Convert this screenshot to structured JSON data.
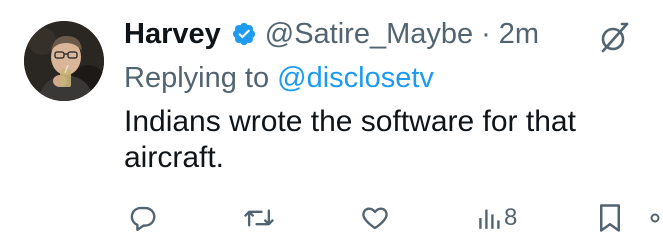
{
  "tweet": {
    "author": {
      "display_name": "Harvey",
      "handle": "@Satire_Maybe",
      "verified": true,
      "avatar_icon": "profile-photo"
    },
    "separator": "·",
    "time": "2m",
    "replying_label": "Replying to",
    "replying_to": "@disclosetv",
    "text": "Indians wrote the software for that aircraft.",
    "metrics": {
      "views": "8"
    },
    "icons": {
      "grok": "grok-icon",
      "reply": "reply-icon",
      "retweet": "retweet-icon",
      "like": "like-icon",
      "views": "views-icon",
      "bookmark": "bookmark-icon",
      "share": "share-icon"
    },
    "colors": {
      "text": "#0f1419",
      "secondary": "#536471",
      "accent": "#1d9bf0"
    }
  }
}
